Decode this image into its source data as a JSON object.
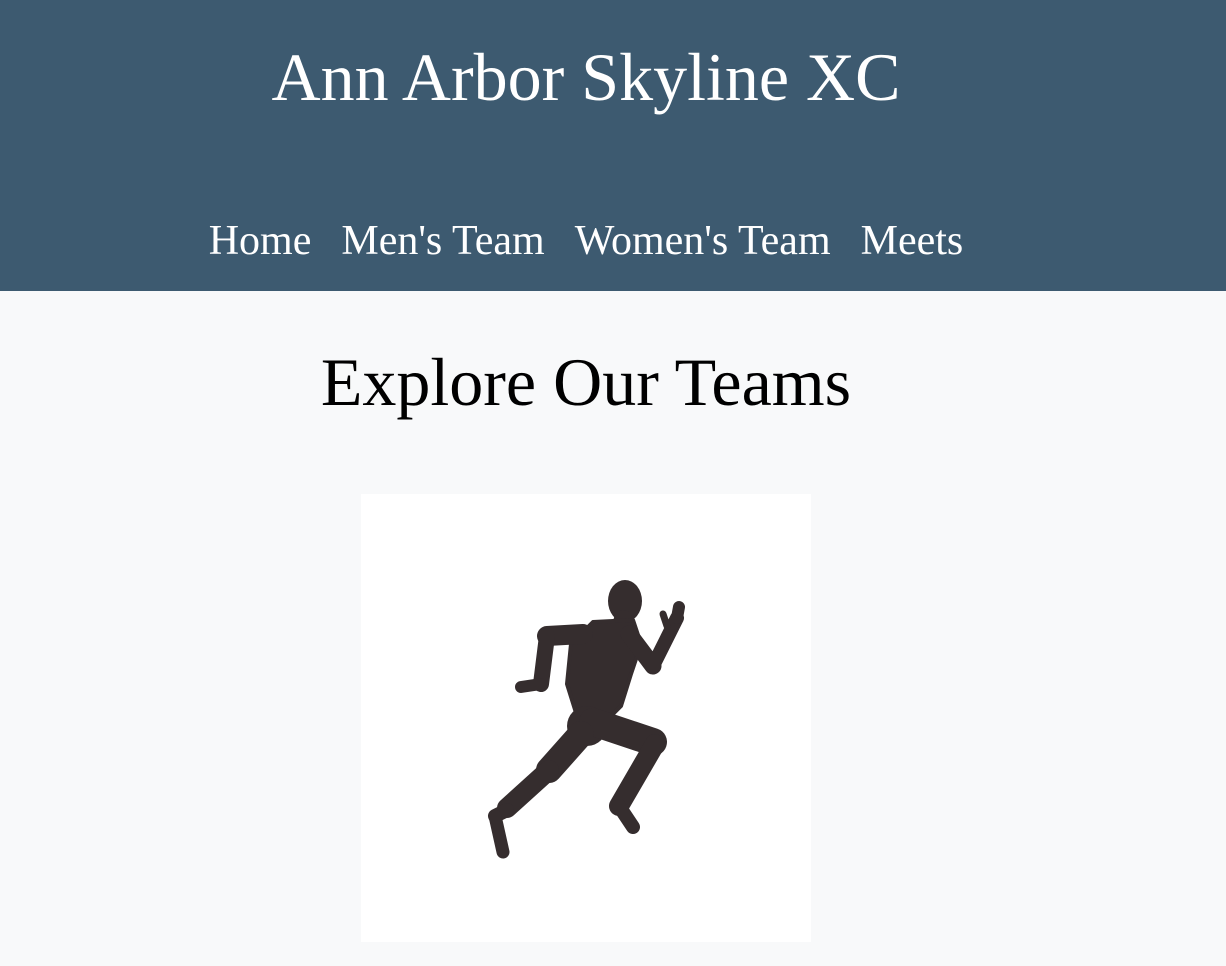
{
  "header": {
    "title": "Ann Arbor Skyline XC",
    "background_color": "#3d5a70"
  },
  "nav": {
    "items": [
      {
        "label": "Home"
      },
      {
        "label": "Men's Team"
      },
      {
        "label": "Women's Team"
      },
      {
        "label": "Meets"
      }
    ]
  },
  "main": {
    "heading": "Explore Our Teams",
    "team_cards": [
      {
        "image": "runner-silhouette-icon",
        "image_color": "#352d2e"
      }
    ]
  },
  "colors": {
    "page_background": "#f8f9fa",
    "header_text": "#ffffff",
    "body_text": "#000000"
  }
}
